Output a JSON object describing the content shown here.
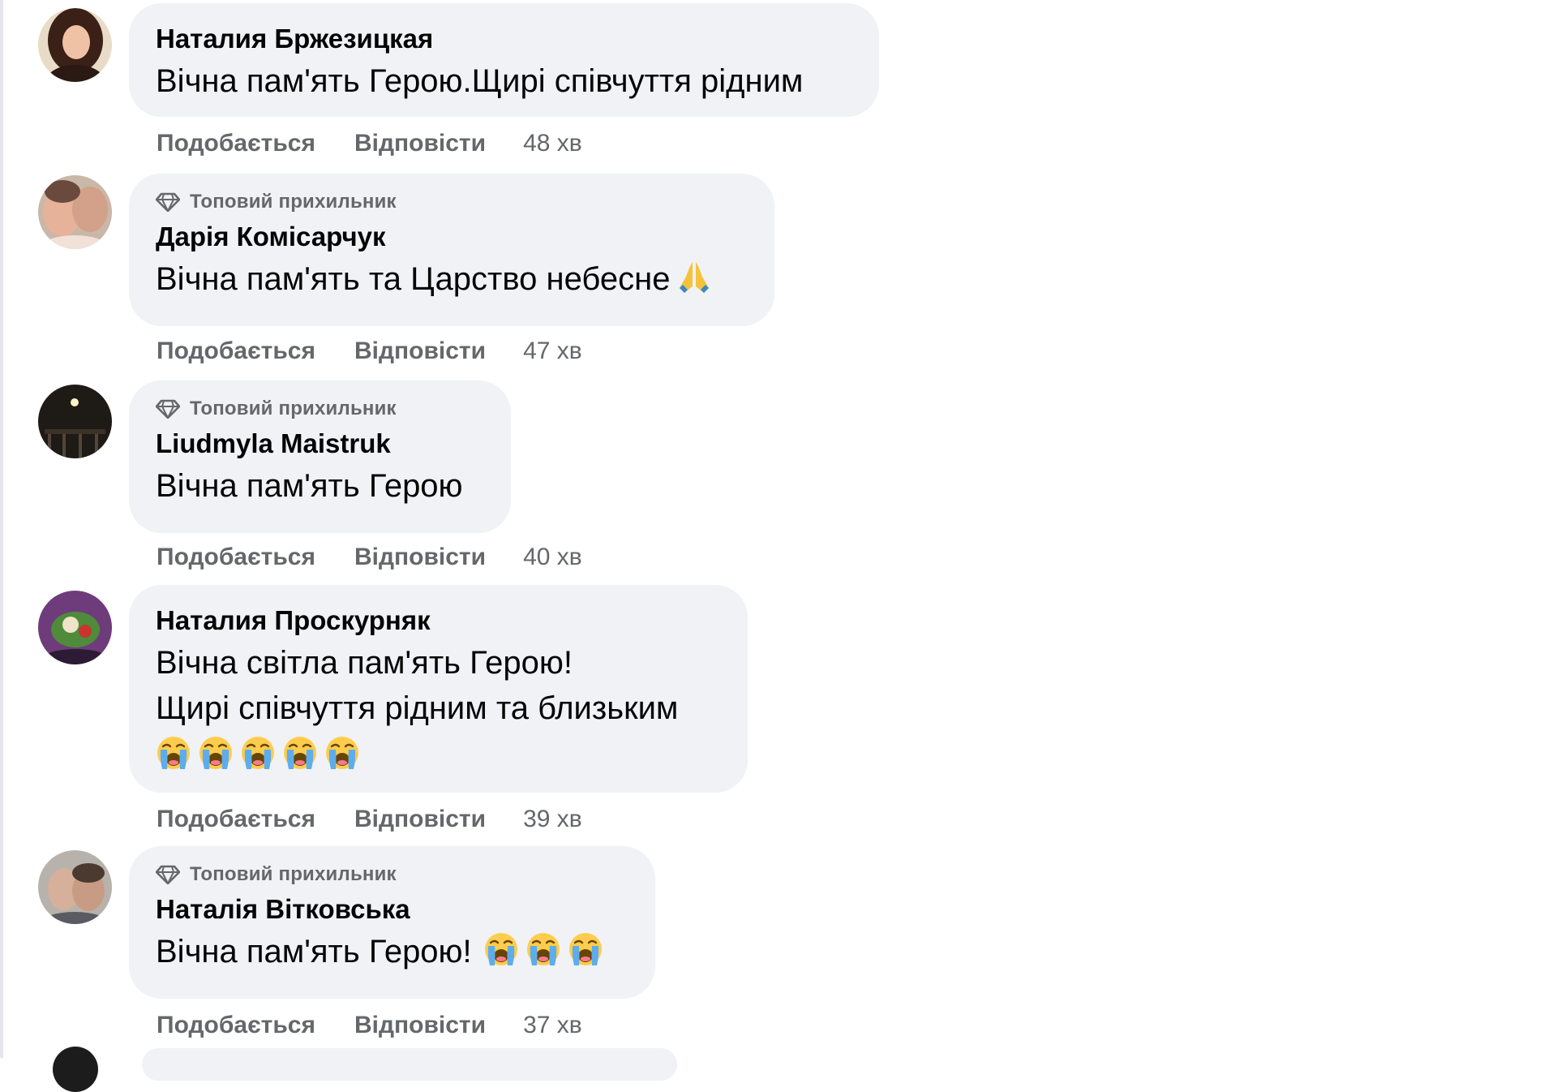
{
  "labels": {
    "top_fan": "Топовий прихильник",
    "like": "Подобається",
    "reply": "Відповісти"
  },
  "icons": {
    "top_fan_badge": "diamond-icon",
    "pray_emoji": "folded-hands-emoji",
    "cry_emoji": "loudly-crying-emoji"
  },
  "colors": {
    "bubble": "#f0f2f5",
    "secondary_text": "#65676b",
    "primary_text": "#050505"
  },
  "comments": [
    {
      "author": "Наталия Бржезицкая",
      "top_fan": false,
      "lines": [
        "Вічна пам'ять Герою.Щирі співчуття рідним"
      ],
      "time": "48 хв"
    },
    {
      "author": "Дарія Комісарчук",
      "top_fan": true,
      "lines": [
        "Вічна пам'ять та Царство небесне"
      ],
      "trailing_emoji": [
        "folded-hands-emoji"
      ],
      "time": "47 хв"
    },
    {
      "author": "Liudmyla Maistruk",
      "top_fan": true,
      "lines": [
        "Вічна пам'ять Герою"
      ],
      "time": "40 хв"
    },
    {
      "author": "Наталия Проскурняк",
      "top_fan": false,
      "lines": [
        "Вічна світла пам'ять Герою!",
        "Щирі співчуття рідним та близьким"
      ],
      "emoji_line": [
        "loudly-crying-emoji",
        "loudly-crying-emoji",
        "loudly-crying-emoji",
        "loudly-crying-emoji",
        "loudly-crying-emoji"
      ],
      "time": "39 хв"
    },
    {
      "author": "Наталія Вітковська",
      "top_fan": true,
      "lines": [
        "Вічна пам'ять Герою!"
      ],
      "trailing_emoji": [
        "loudly-crying-emoji",
        "loudly-crying-emoji",
        "loudly-crying-emoji"
      ],
      "time": "37 хв"
    }
  ]
}
